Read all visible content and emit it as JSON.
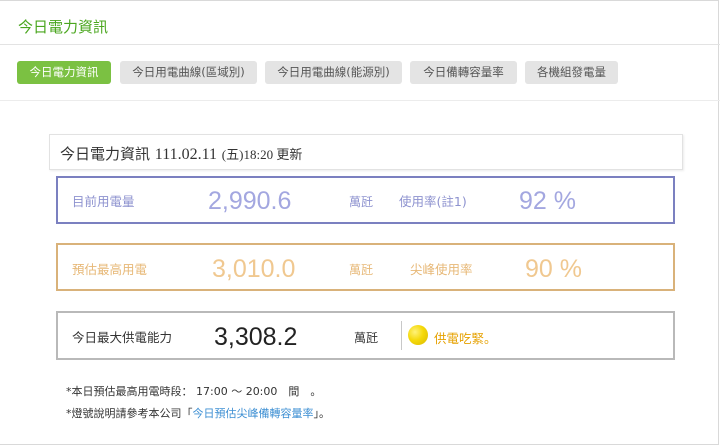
{
  "header": {
    "title": "今日電力資訊"
  },
  "tabs": [
    {
      "label": "今日電力資訊",
      "active": true
    },
    {
      "label": "今日用電曲線(區域別)",
      "active": false
    },
    {
      "label": "今日用電曲線(能源別)",
      "active": false
    },
    {
      "label": "今日備轉容量率",
      "active": false
    },
    {
      "label": "各機組發電量",
      "active": false
    }
  ],
  "info": {
    "title": "今日電力資訊",
    "date": "111.02.11",
    "weekday": "(五)",
    "time_update": "18:20 更新"
  },
  "current": {
    "label": "目前用電量",
    "value": "2,990.6",
    "unit": "萬瓩",
    "rate_label": "使用率(註1)",
    "rate_value": "92 %"
  },
  "forecast": {
    "label": "預估最高用電",
    "value": "3,010.0",
    "unit": "萬瓩",
    "rate_label": "尖峰使用率",
    "rate_value": "90 %"
  },
  "capacity": {
    "label": "今日最大供電能力",
    "value": "3,308.2",
    "unit": "萬瓩",
    "status": "供電吃緊。"
  },
  "notes": {
    "line1": "*本日預估最高用電時段： 17:00 ～ 20:00　間　。",
    "line2_prefix": "*燈號說明請參考本公司「",
    "line2_link": "今日預估尖峰備轉容量率",
    "line2_suffix": "」。"
  },
  "colors": {
    "accent_green": "#7bc142",
    "current_border": "#7b80c0",
    "forecast_border": "#d9b27a",
    "capacity_border": "#b9b9b9",
    "lamp_yellow": "#f5d90a",
    "status_text": "#e6a100"
  }
}
